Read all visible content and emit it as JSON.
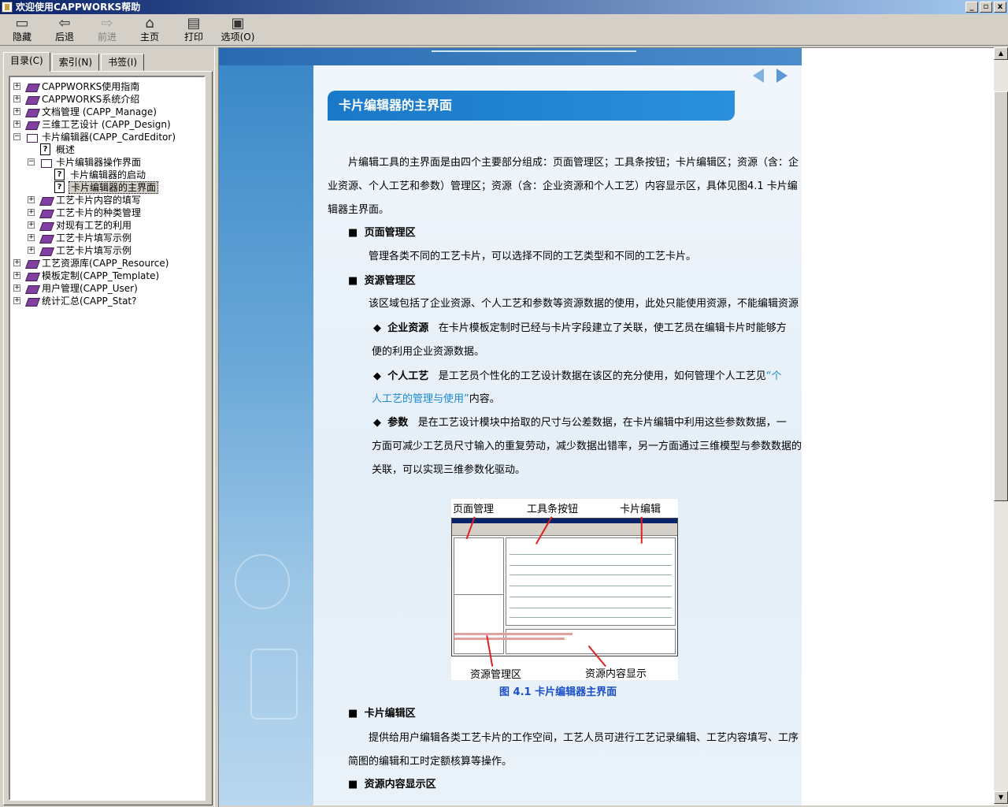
{
  "window": {
    "title": "欢迎使用CAPPWORKS帮助",
    "buttons": [
      "_",
      "▫",
      "x"
    ]
  },
  "toolbar": {
    "hide": "隐藏",
    "back": "后退",
    "forward": "前进",
    "home": "主页",
    "print": "打印",
    "options": "选项(O)"
  },
  "tabs": {
    "contents": "目录(C)",
    "index": "索引(N)",
    "bookmarks": "书签(I)"
  },
  "tree": [
    "CAPPWORKS使用指南",
    "CAPPWORKS系统介绍",
    "文档管理 (CAPP_Manage)",
    "三维工艺设计 (CAPP_Design)",
    "卡片编辑器(CAPP_CardEditor)",
    "概述",
    "卡片编辑器操作界面",
    "卡片编辑器的启动",
    "卡片编辑器的主界面",
    "工艺卡片内容的填写",
    "工艺卡片的种类管理",
    "对现有工艺的利用",
    "工艺卡片填写示例",
    "工艺卡片填写示例",
    "工艺资源库(CAPP_Resource)",
    "模板定制(CAPP_Template)",
    "用户管理(CAPP_User)",
    "统计汇总(CAPP_Stat?"
  ],
  "article": {
    "heading": "卡片编辑器的主界面",
    "intro1": "片编辑工具的主界面是由四个主要部分组成：页面管理区；工具条按钮；卡片编辑区；资源（含：企",
    "intro2": "业资源、个人工艺和参数）管理区；资源（含：企业资源和个人工艺）内容显示区，具体见图4.1 卡片编",
    "intro3": "辑器主界面。",
    "sec1_title": "页面管理区",
    "sec1_text": "管理各类不同的工艺卡片，可以选择不同的工艺类型和不同的工艺卡片。",
    "sec2_title": "资源管理区",
    "sec2_text": "该区域包括了企业资源、个人工艺和参数等资源数据的使用，此处只能使用资源，不能编辑资源",
    "b1_title": "企业资源",
    "b1_text1": "在卡片模板定制时已经与卡片字段建立了关联，使工艺员在编辑卡片时能够方",
    "b1_text2": "便的利用企业资源数据。",
    "b2_title": "个人工艺",
    "b2_text1": "是工艺员个性化的工艺设计数据在该区的充分使用，如何管理个人工艺见",
    "b2_link1": "“个",
    "b2_link2": "人工艺的管理与使用”",
    "b2_text2": "内容。",
    "b3_title": "参数",
    "b3_text1": "是在工艺设计模块中拾取的尺寸与公差数据，在卡片编辑中利用这些参数数据，一",
    "b3_text2": "方面可减少工艺员尺寸输入的重复劳动，减少数据出错率，另一方面通过三维模型与参数数据的",
    "b3_text3": "关联，可以实现三维参数化驱动。",
    "fig_label_page": "页面管理",
    "fig_label_toolbar": "工具条按钮",
    "fig_label_card": "卡片编辑",
    "fig_label_res": "资源管理区",
    "fig_label_content": "资源内容显示",
    "fig_caption": "图 4.1 卡片编辑器主界面",
    "sec3_title": "卡片编辑区",
    "sec3_text1": "提供给用户编辑各类工艺卡片的工作空间，工艺人员可进行工艺记录编辑、工艺内容填写、工序",
    "sec3_text2": "简图的编辑和工时定额核算等操作。",
    "sec4_title": "资源内容显示区",
    "bullet_square": "■",
    "bullet_diamond": "◆"
  }
}
